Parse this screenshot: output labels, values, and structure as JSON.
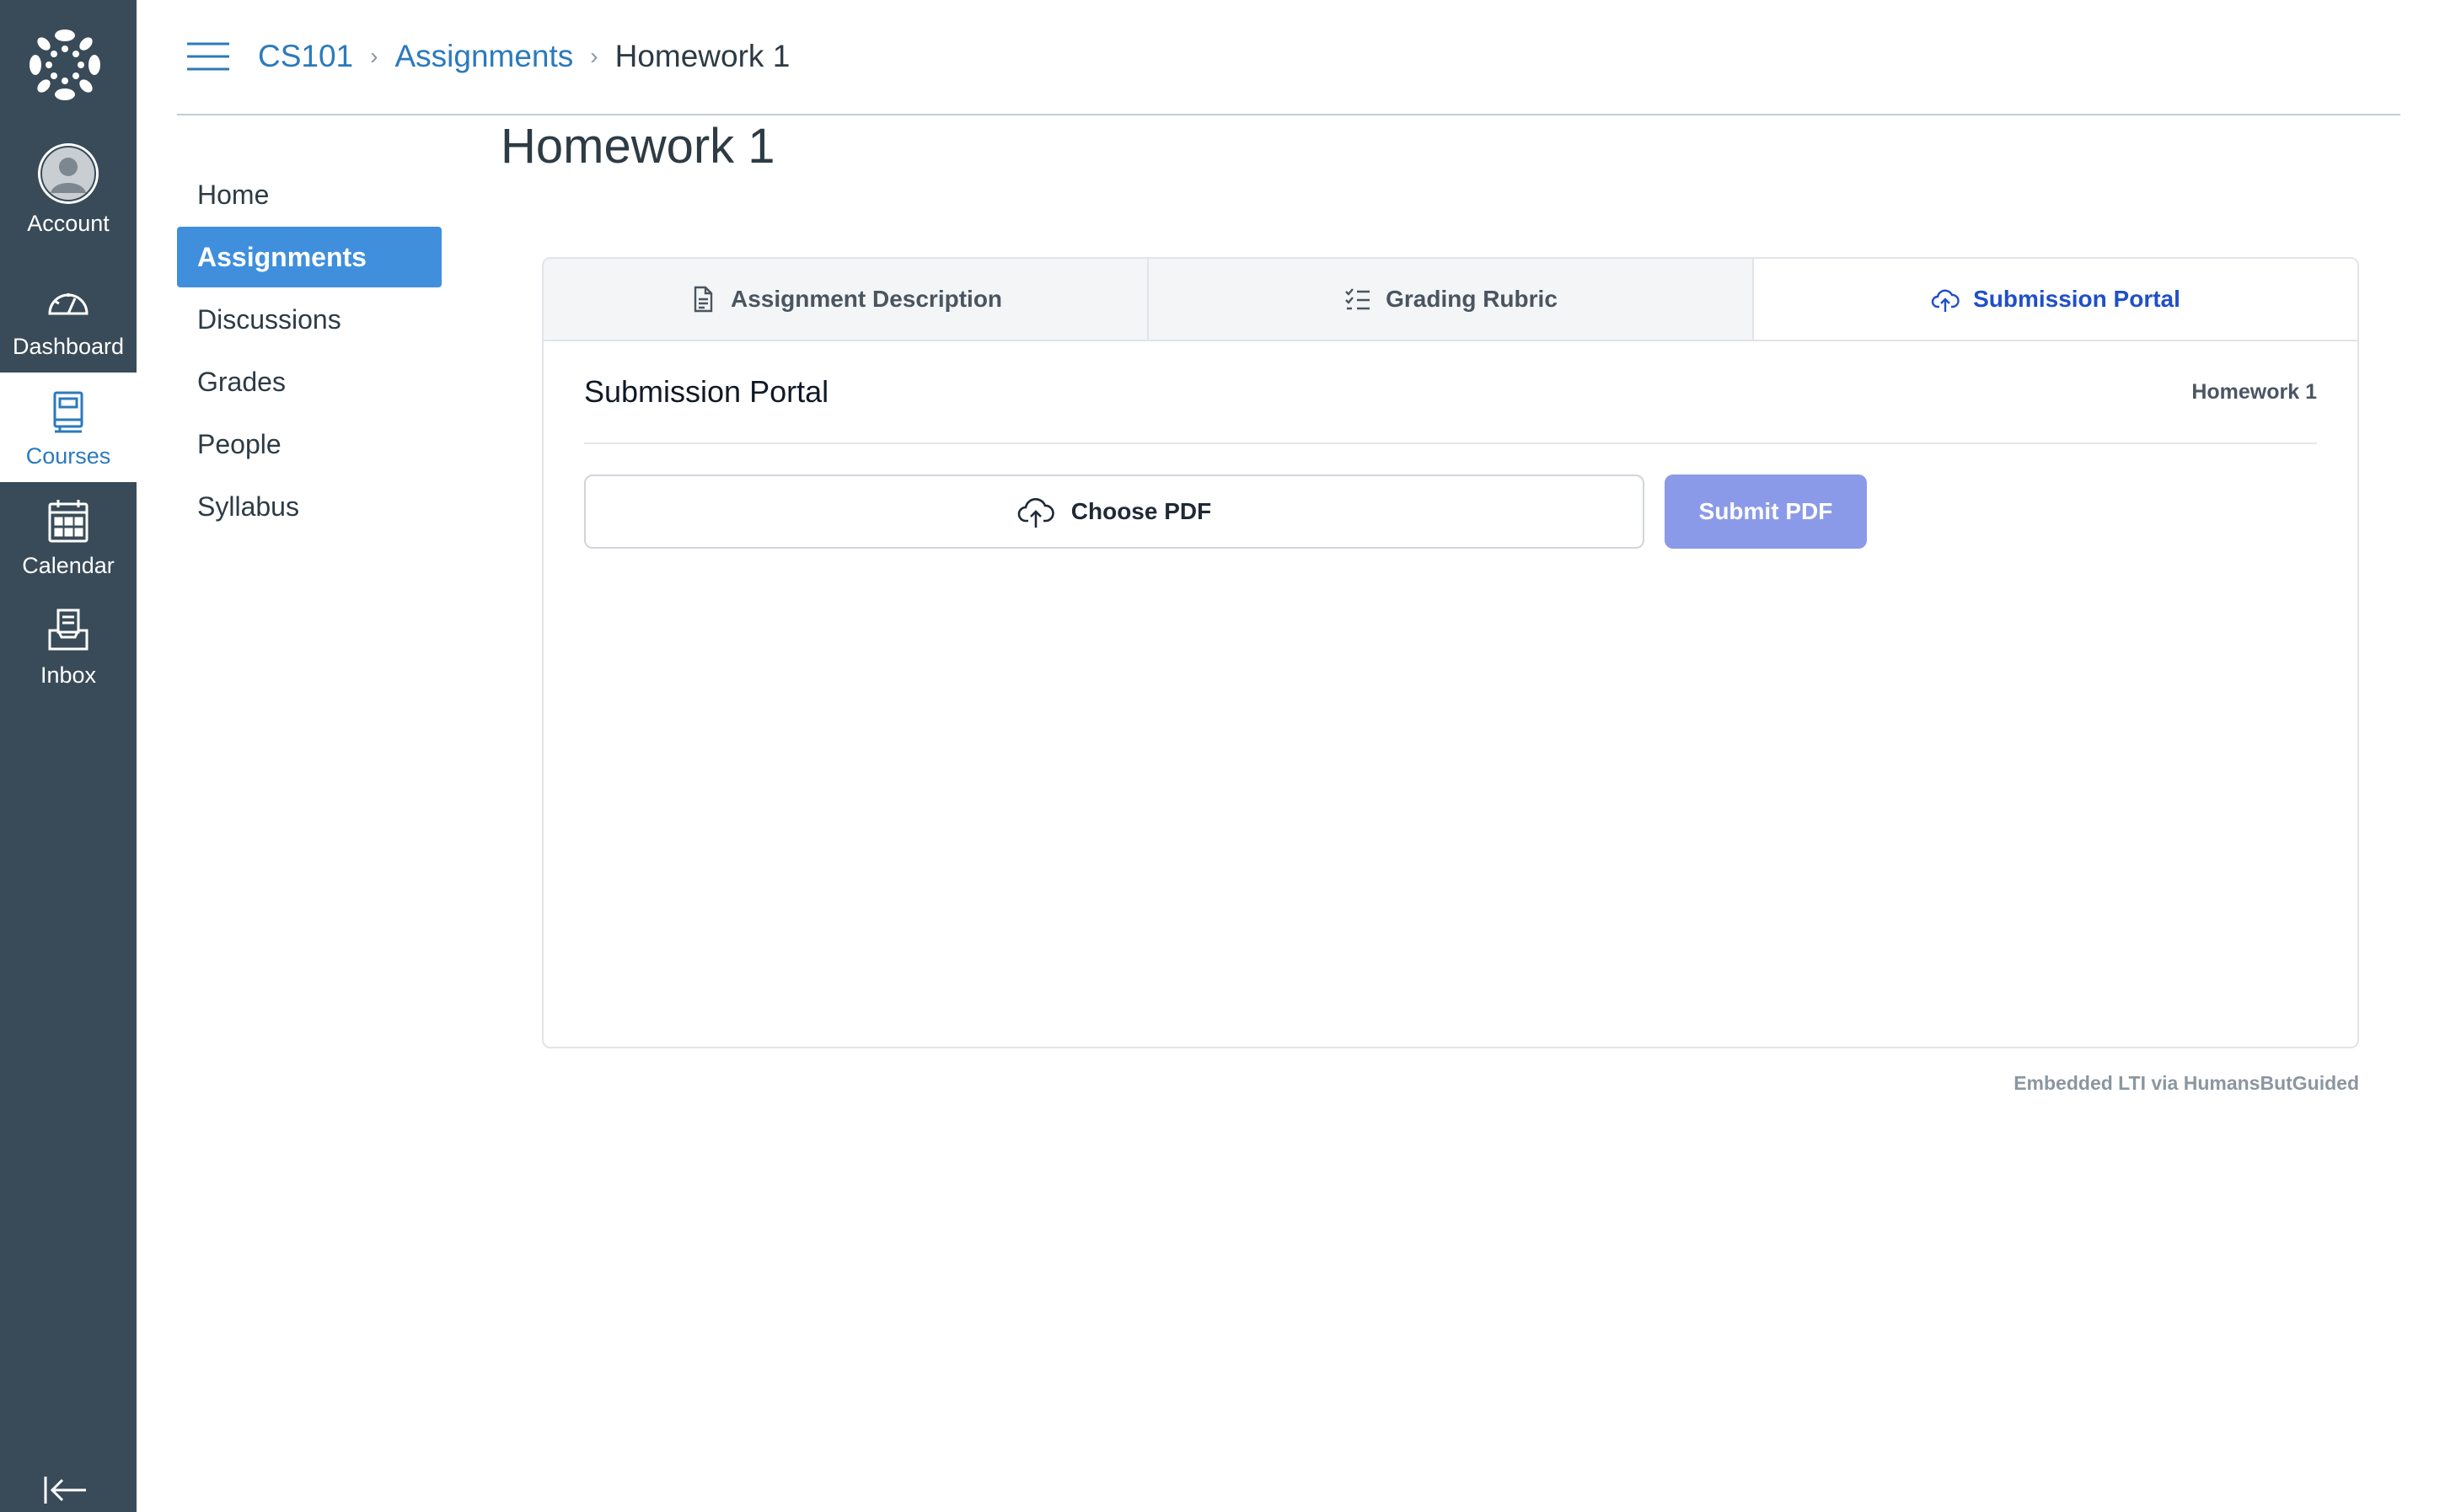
{
  "global_nav": {
    "items": [
      {
        "label": "Account",
        "icon": "avatar-icon"
      },
      {
        "label": "Dashboard",
        "icon": "dashboard-icon"
      },
      {
        "label": "Courses",
        "icon": "courses-icon"
      },
      {
        "label": "Calendar",
        "icon": "calendar-icon"
      },
      {
        "label": "Inbox",
        "icon": "inbox-icon"
      }
    ],
    "active": "Courses",
    "active_color": "#2b7abc",
    "background": "#394b58"
  },
  "breadcrumb": {
    "items": [
      "CS101",
      "Assignments"
    ],
    "current": "Homework 1"
  },
  "course_nav": {
    "items": [
      "Home",
      "Assignments",
      "Discussions",
      "Grades",
      "People",
      "Syllabus"
    ],
    "active": "Assignments"
  },
  "page": {
    "title": "Homework 1"
  },
  "lti": {
    "tabs": [
      {
        "label": "Assignment Description",
        "icon": "document-icon"
      },
      {
        "label": "Grading Rubric",
        "icon": "checklist-icon"
      },
      {
        "label": "Submission Portal",
        "icon": "cloud-upload-icon"
      }
    ],
    "active_tab": "Submission Portal",
    "panel": {
      "title": "Submission Portal",
      "subtitle": "Homework 1",
      "choose_label": "Choose PDF",
      "submit_label": "Submit PDF"
    },
    "footer": "Embedded LTI via HumansButGuided"
  }
}
